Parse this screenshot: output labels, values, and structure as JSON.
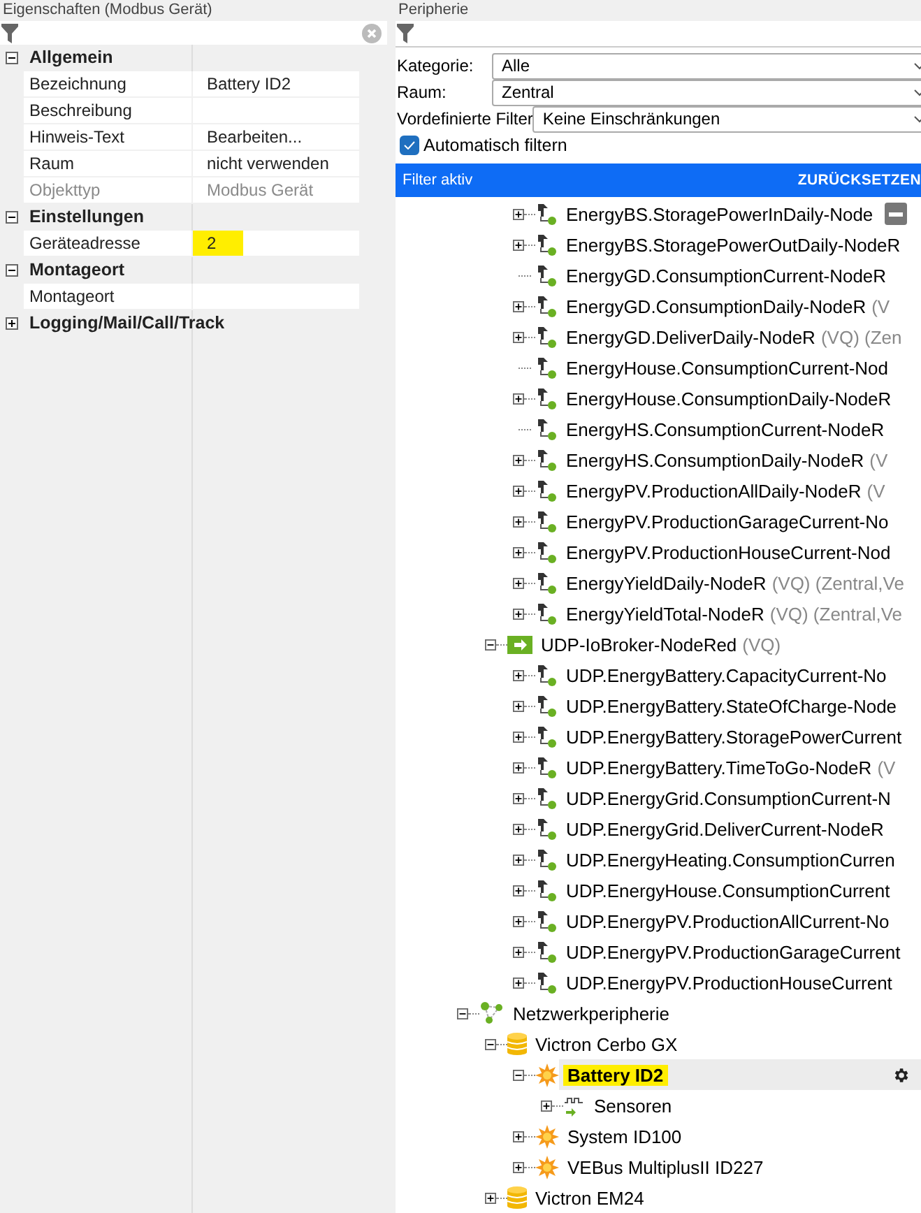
{
  "properties_panel": {
    "title": "Eigenschaften (Modbus Gerät)",
    "sections": [
      {
        "title": "Allgemein",
        "expanded": true,
        "rows": [
          {
            "name": "Bezeichnung",
            "value": "Battery ID2",
            "disabled": false,
            "highlighted": false
          },
          {
            "name": "Beschreibung",
            "value": "",
            "disabled": false,
            "highlighted": false
          },
          {
            "name": "Hinweis-Text",
            "value": "Bearbeiten...",
            "disabled": false,
            "highlighted": false
          },
          {
            "name": "Raum",
            "value": "nicht verwenden",
            "disabled": false,
            "highlighted": false
          },
          {
            "name": "Objekttyp",
            "value": "Modbus Gerät",
            "disabled": true,
            "highlighted": false
          }
        ]
      },
      {
        "title": "Einstellungen",
        "expanded": true,
        "rows": [
          {
            "name": "Geräteadresse",
            "value": "2",
            "disabled": false,
            "highlighted": true
          }
        ]
      },
      {
        "title": "Montageort",
        "expanded": true,
        "rows": [
          {
            "name": "Montageort",
            "value": "",
            "disabled": false,
            "highlighted": false
          }
        ]
      },
      {
        "title": "Logging/Mail/Call/Track",
        "expanded": false
      }
    ]
  },
  "peripherals_panel": {
    "title": "Peripherie",
    "filters": [
      {
        "label": "Kategorie:",
        "value": "Alle"
      },
      {
        "label": "Raum:",
        "value": "Zentral"
      },
      {
        "label": "Vordefinierte Filter",
        "value": "Keine Einschränkungen"
      }
    ],
    "auto_filter": {
      "label": "Automatisch filtern",
      "checked": true
    },
    "filter_bar": {
      "text": "Filter aktiv",
      "action": "ZURÜCKSETZEN"
    },
    "tree": [
      {
        "children": [
          {
            "children": [
              {
                "label": "EnergyBS.StoragePowerInDaily-Node",
                "kind": "flow",
                "expanded": false,
                "selected": false
              },
              {
                "label": "EnergyBS.StoragePowerOutDaily-NodeR",
                "kind": "flow",
                "expanded": false,
                "selected": false
              },
              {
                "label": "EnergyGD.ConsumptionCurrent-NodeR",
                "kind": "flow",
                "selected": false
              },
              {
                "label": "EnergyGD.ConsumptionDaily-NodeR",
                "suffix": "(V",
                "kind": "flow",
                "expanded": false,
                "selected": false
              },
              {
                "label": "EnergyGD.DeliverDaily-NodeR",
                "suffix": "(VQ) (Zen",
                "kind": "flow",
                "expanded": false,
                "selected": false
              },
              {
                "label": "EnergyHouse.ConsumptionCurrent-Nod",
                "kind": "flow",
                "selected": false
              },
              {
                "label": "EnergyHouse.ConsumptionDaily-NodeR",
                "kind": "flow",
                "expanded": false,
                "selected": false
              },
              {
                "label": "EnergyHS.ConsumptionCurrent-NodeR",
                "kind": "flow",
                "selected": false
              },
              {
                "label": "EnergyHS.ConsumptionDaily-NodeR",
                "suffix": "(V",
                "kind": "flow",
                "expanded": false,
                "selected": false
              },
              {
                "label": "EnergyPV.ProductionAllDaily-NodeR",
                "suffix": "(V",
                "kind": "flow",
                "expanded": false,
                "selected": false
              },
              {
                "label": "EnergyPV.ProductionGarageCurrent-No",
                "kind": "flow",
                "expanded": false,
                "selected": false
              },
              {
                "label": "EnergyPV.ProductionHouseCurrent-Nod",
                "kind": "flow",
                "expanded": false,
                "selected": false
              },
              {
                "label": "EnergyYieldDaily-NodeR",
                "suffix": "(VQ) (Zentral,Ve",
                "kind": "flow",
                "expanded": false,
                "selected": false
              },
              {
                "label": "EnergyYieldTotal-NodeR",
                "suffix": "(VQ) (Zentral,Ve",
                "kind": "flow",
                "expanded": false,
                "selected": false
              }
            ]
          },
          {
            "label": "UDP-IoBroker-NodeRed",
            "suffix": "(VQ)",
            "kind": "udp",
            "expanded": true,
            "selected": false,
            "children": [
              {
                "label": "UDP.EnergyBattery.CapacityCurrent-No",
                "kind": "flow",
                "expanded": false,
                "selected": false
              },
              {
                "label": "UDP.EnergyBattery.StateOfCharge-Node",
                "kind": "flow",
                "expanded": false,
                "selected": false
              },
              {
                "label": "UDP.EnergyBattery.StoragePowerCurrent",
                "kind": "flow",
                "expanded": false,
                "selected": false
              },
              {
                "label": "UDP.EnergyBattery.TimeToGo-NodeR",
                "suffix": "(V",
                "kind": "flow",
                "expanded": false,
                "selected": false
              },
              {
                "label": "UDP.EnergyGrid.ConsumptionCurrent-N",
                "kind": "flow",
                "expanded": false,
                "selected": false
              },
              {
                "label": "UDP.EnergyGrid.DeliverCurrent-NodeR",
                "kind": "flow",
                "expanded": false,
                "selected": false
              },
              {
                "label": "UDP.EnergyHeating.ConsumptionCurren",
                "kind": "flow",
                "expanded": false,
                "selected": false
              },
              {
                "label": "UDP.EnergyHouse.ConsumptionCurrent",
                "kind": "flow",
                "expanded": false,
                "selected": false
              },
              {
                "label": "UDP.EnergyPV.ProductionAllCurrent-No",
                "kind": "flow",
                "expanded": false,
                "selected": false
              },
              {
                "label": "UDP.EnergyPV.ProductionGarageCurrent",
                "kind": "flow",
                "expanded": false,
                "selected": false
              },
              {
                "label": "UDP.EnergyPV.ProductionHouseCurrent",
                "kind": "flow",
                "expanded": false,
                "selected": false
              }
            ]
          }
        ]
      },
      {
        "label": "Netzwerkperipherie",
        "kind": "network",
        "expanded": true,
        "selected": false,
        "children": [
          {
            "label": "Victron Cerbo GX",
            "kind": "database",
            "expanded": true,
            "selected": false,
            "children": [
              {
                "label": "Battery ID2",
                "kind": "device",
                "expanded": true,
                "selected": true,
                "children": [
                  {
                    "label": "Sensoren",
                    "kind": "sensor",
                    "expanded": false,
                    "selected": false
                  }
                ]
              },
              {
                "label": "System ID100",
                "kind": "device",
                "expanded": false,
                "selected": false
              },
              {
                "label": "VEBus MultiplusII ID227",
                "kind": "device",
                "expanded": false,
                "selected": false
              }
            ]
          },
          {
            "label": "Victron EM24",
            "kind": "database",
            "expanded": false,
            "selected": false
          }
        ]
      }
    ]
  }
}
